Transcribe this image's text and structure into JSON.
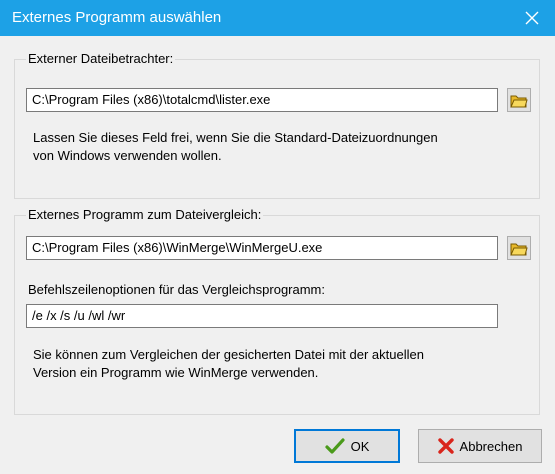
{
  "window": {
    "title": "Externes Programm auswählen",
    "close_icon": "close-icon"
  },
  "viewer_group": {
    "label": "Externer Dateibetrachter:",
    "path_value": "C:\\Program Files (x86)\\totalcmd\\lister.exe",
    "browse_icon": "folder-icon",
    "hint_line1": "Lassen Sie dieses Feld frei, wenn Sie die Standard-Dateizuordnungen",
    "hint_line2": "von Windows verwenden wollen."
  },
  "compare_group": {
    "label": "Externes Programm zum Dateivergleich:",
    "path_value": "C:\\Program Files (x86)\\WinMerge\\WinMergeU.exe",
    "browse_icon": "folder-icon",
    "options_label": "Befehlszeilenoptionen für das Vergleichsprogramm:",
    "options_value": "/e /x /s /u /wl /wr",
    "hint_line1": "Sie können zum Vergleichen der gesicherten Datei mit der aktuellen",
    "hint_line2": "Version ein Programm wie WinMerge verwenden."
  },
  "buttons": {
    "ok_label": "OK",
    "ok_icon": "checkmark-icon",
    "cancel_label": "Abbrechen",
    "cancel_icon": "red-x-icon"
  },
  "colors": {
    "titlebar": "#1da1e6",
    "default_button_border": "#0078d7"
  }
}
